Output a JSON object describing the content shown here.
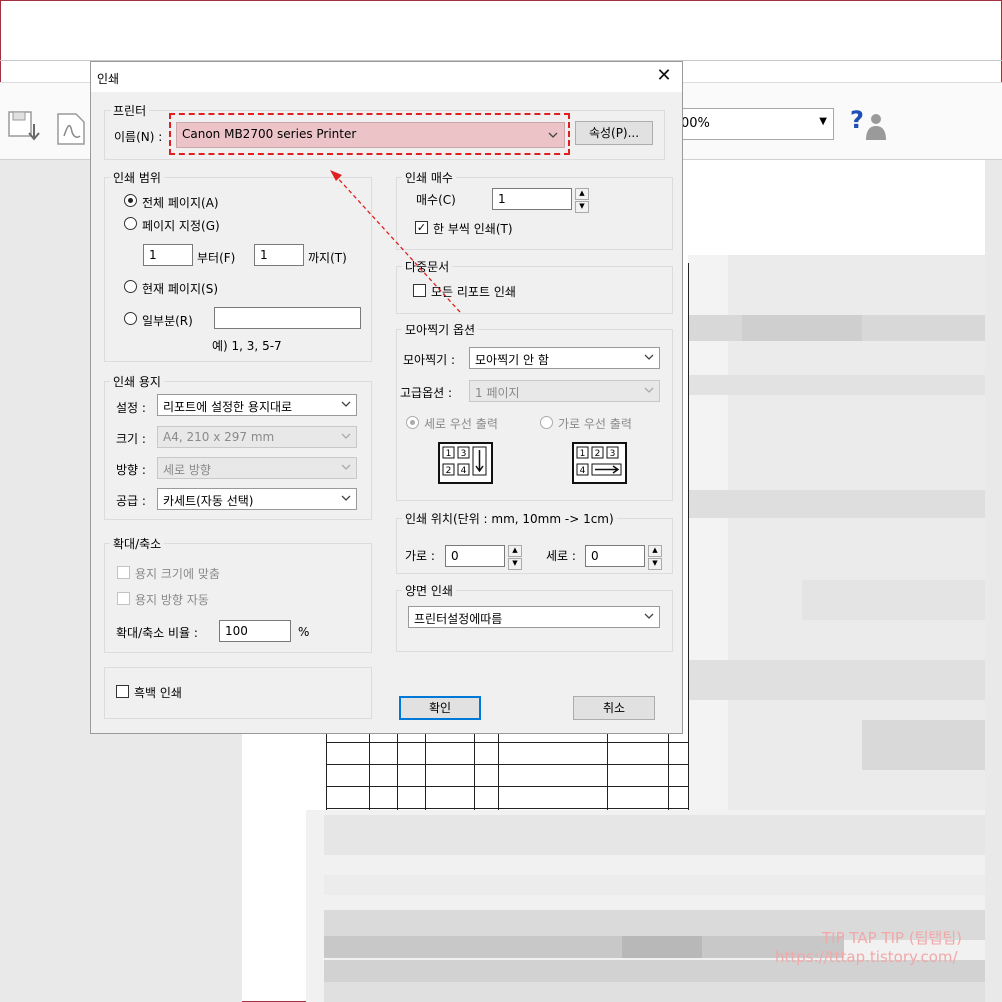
{
  "dialog": {
    "title": "인쇄",
    "printer": {
      "group": "프린터",
      "name_label": "이름(N) :",
      "name_value": "Canon MB2700 series Printer",
      "properties_button": "속성(P)..."
    },
    "range": {
      "group": "인쇄 범위",
      "all_pages": "전체 페이지(A)",
      "page_range": "페이지 지정(G)",
      "from_value": "1",
      "from_label": "부터(F)",
      "to_value": "1",
      "to_label": "까지(T)",
      "current_page": "현재 페이지(S)",
      "partial": "일부분(R)",
      "partial_value": "",
      "example": "예) 1, 3, 5-7"
    },
    "paper": {
      "group": "인쇄 용지",
      "setting_label": "설정 :",
      "setting_value": "리포트에 설정한 용지대로",
      "size_label": "크기 :",
      "size_value": "A4, 210 x 297 mm",
      "orientation_label": "방향 :",
      "orientation_value": "세로 방향",
      "source_label": "공급 :",
      "source_value": "카세트(자동 선택)"
    },
    "scale": {
      "group": "확대/축소",
      "fit_paper": "용지 크기에 맞춤",
      "auto_orient": "용지 방향 자동",
      "ratio_label": "확대/축소 비율 :",
      "ratio_value": "100",
      "ratio_unit": "%"
    },
    "mono": {
      "label": "흑백 인쇄"
    },
    "copies": {
      "group": "인쇄 매수",
      "count_label": "매수(C)",
      "count_value": "1",
      "collate": "한 부씩 인쇄(T)"
    },
    "multi_doc": {
      "group": "다중문서",
      "all_reports": "모든 리포트 인쇄"
    },
    "nup": {
      "group": "모아찍기 옵션",
      "nup_label": "모아찍기 :",
      "nup_value": "모아찍기 안 함",
      "advanced_label": "고급옵션 :",
      "advanced_value": "1 페이지",
      "vertical_first": "세로 우선 출력",
      "horizontal_first": "가로 우선 출력",
      "cells": [
        "1",
        "3",
        "2",
        "4",
        "1",
        "2",
        "3",
        "4"
      ]
    },
    "position": {
      "group": "인쇄 위치(단위 : mm, 10mm -> 1cm)",
      "h_label": "가로 :",
      "h_value": "0",
      "v_label": "세로 :",
      "v_value": "0"
    },
    "duplex": {
      "group": "양면 인쇄",
      "value": "프린터설정에따름"
    },
    "ok_button": "확인",
    "cancel_button": "취소"
  },
  "toolbar": {
    "zoom_value": "00%",
    "help_glyph": "?"
  },
  "watermark": {
    "line1": "TIP TAP TIP (팁탭팁)",
    "line2": "https://tttap.tistory.com/"
  },
  "colors": {
    "highlight": "#e02020",
    "accent": "#0078d7",
    "printer_bg": "#ecc4c8"
  }
}
